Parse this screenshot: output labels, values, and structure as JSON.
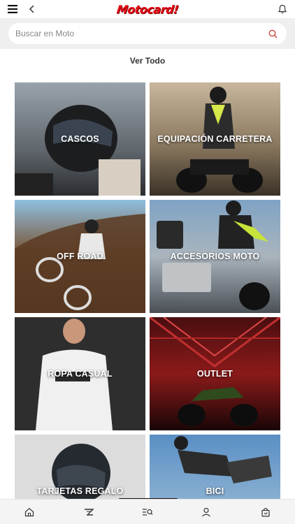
{
  "header": {
    "logo_text": "Motocard!",
    "menu_icon": "hamburger-icon",
    "back_icon": "chevron-left-icon",
    "notification_icon": "bell-icon"
  },
  "search": {
    "placeholder": "Buscar en Moto",
    "icon": "search-icon"
  },
  "view_all_label": "Ver Todo",
  "categories": [
    {
      "label": "CASCOS"
    },
    {
      "label": "EQUIPACIÓN CARRETERA"
    },
    {
      "label": "OFF ROAD"
    },
    {
      "label": "ACCESORIOS MOTO"
    },
    {
      "label": "ROPA CASUAL"
    },
    {
      "label": "OUTLET"
    },
    {
      "label": "TARJETAS REGALO"
    },
    {
      "label": "BICI"
    }
  ],
  "bottom_nav": [
    {
      "icon": "home-icon"
    },
    {
      "icon": "brand-icon"
    },
    {
      "icon": "category-search-icon"
    },
    {
      "icon": "user-icon"
    },
    {
      "icon": "shopping-bag-icon"
    }
  ],
  "colors": {
    "brand_red": "#e30613",
    "search_icon": "#d0453a"
  }
}
